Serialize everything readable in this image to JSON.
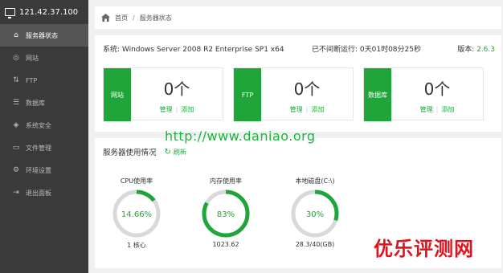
{
  "sidebar": {
    "ip": "121.42.37.100",
    "items": [
      {
        "label": "服务器状态",
        "icon": "home-icon",
        "glyph": "⌂",
        "active": true
      },
      {
        "label": "网站",
        "icon": "globe-icon",
        "glyph": "◎",
        "active": false
      },
      {
        "label": "FTP",
        "icon": "ftp-icon",
        "glyph": "⇅",
        "active": false
      },
      {
        "label": "数据库",
        "icon": "database-icon",
        "glyph": "☰",
        "active": false
      },
      {
        "label": "系统安全",
        "icon": "shield-icon",
        "glyph": "◈",
        "active": false
      },
      {
        "label": "文件管理",
        "icon": "folder-icon",
        "glyph": "▭",
        "active": false
      },
      {
        "label": "环境设置",
        "icon": "gear-icon",
        "glyph": "⚙",
        "active": false
      },
      {
        "label": "退出面板",
        "icon": "logout-icon",
        "glyph": "⇥",
        "active": false
      }
    ]
  },
  "breadcrumb": {
    "home": "首页",
    "current": "服务器状态"
  },
  "system": {
    "os": "系统: Windows Server 2008 R2 Enterprise SP1 x64",
    "uptime": "已不间断运行: 0天01时08分25秒",
    "version_label": "版本: ",
    "version": "2.6.3"
  },
  "cards": [
    {
      "tag": "网站",
      "count": "0个",
      "manage": "管理",
      "add": "添加"
    },
    {
      "tag": "FTP",
      "count": "0个",
      "manage": "管理",
      "add": "添加"
    },
    {
      "tag": "数据库",
      "count": "0个",
      "manage": "管理",
      "add": "添加"
    }
  ],
  "usage": {
    "title": "服务器使用情况",
    "refresh": "刷新",
    "gauges": [
      {
        "label": "CPU使用率",
        "value": "14.66%",
        "percent": 14.66,
        "sub": "1 核心"
      },
      {
        "label": "内存使用率",
        "value": "83%",
        "percent": 83,
        "sub": "1023.62"
      },
      {
        "label": "本地磁盘(C:\\)",
        "value": "30%",
        "percent": 30,
        "sub": "28.3/40(GB)"
      }
    ]
  },
  "watermarks": {
    "url": "http://www.daniao.org",
    "site": "优乐评测网"
  },
  "colors": {
    "accent": "#20a53a",
    "sidebar": "#3a3a3a",
    "track": "#d9d9d9"
  }
}
